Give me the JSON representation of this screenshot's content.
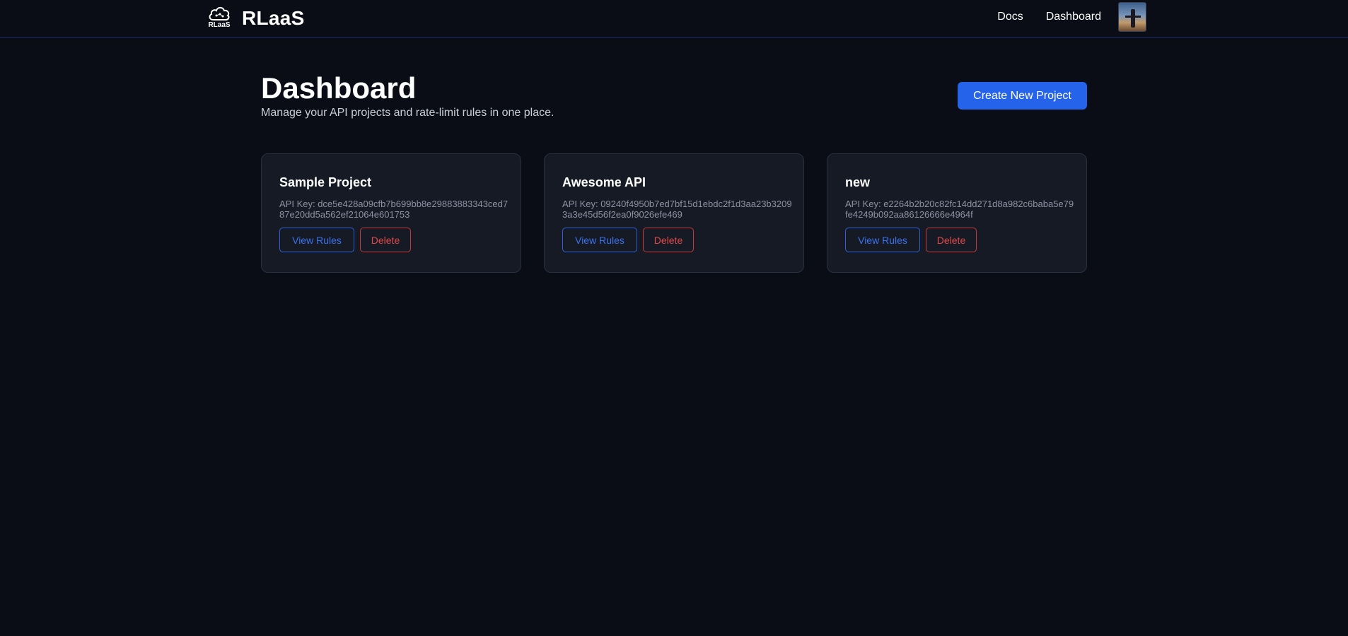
{
  "brand": {
    "logo_text": "RLaaS",
    "name": "RLaaS"
  },
  "nav": {
    "docs": "Docs",
    "dashboard": "Dashboard"
  },
  "page": {
    "title": "Dashboard",
    "subtitle": "Manage your API projects and rate-limit rules in one place.",
    "create_button": "Create New Project"
  },
  "projects": [
    {
      "name": "Sample Project",
      "api_key": "API Key: dce5e428a09cfb7b699bb8e29883883343ced787e20dd5a562ef21064e601753",
      "view_label": "View Rules",
      "delete_label": "Delete"
    },
    {
      "name": "Awesome API",
      "api_key": "API Key: 09240f4950b7ed7bf15d1ebdc2f1d3aa23b32093a3e45d56f2ea0f9026efe469",
      "view_label": "View Rules",
      "delete_label": "Delete"
    },
    {
      "name": "new",
      "api_key": "API Key: e2264b2b20c82fc14dd271d8a982c6baba5e79fe4249b092aa86126666e4964f",
      "view_label": "View Rules",
      "delete_label": "Delete"
    }
  ],
  "colors": {
    "background": "#0a0d16",
    "card": "#161a25",
    "primary": "#2563eb",
    "danger": "#e24848"
  },
  "icons": {
    "logo": "cloud-logo-icon",
    "avatar": "user-avatar"
  }
}
